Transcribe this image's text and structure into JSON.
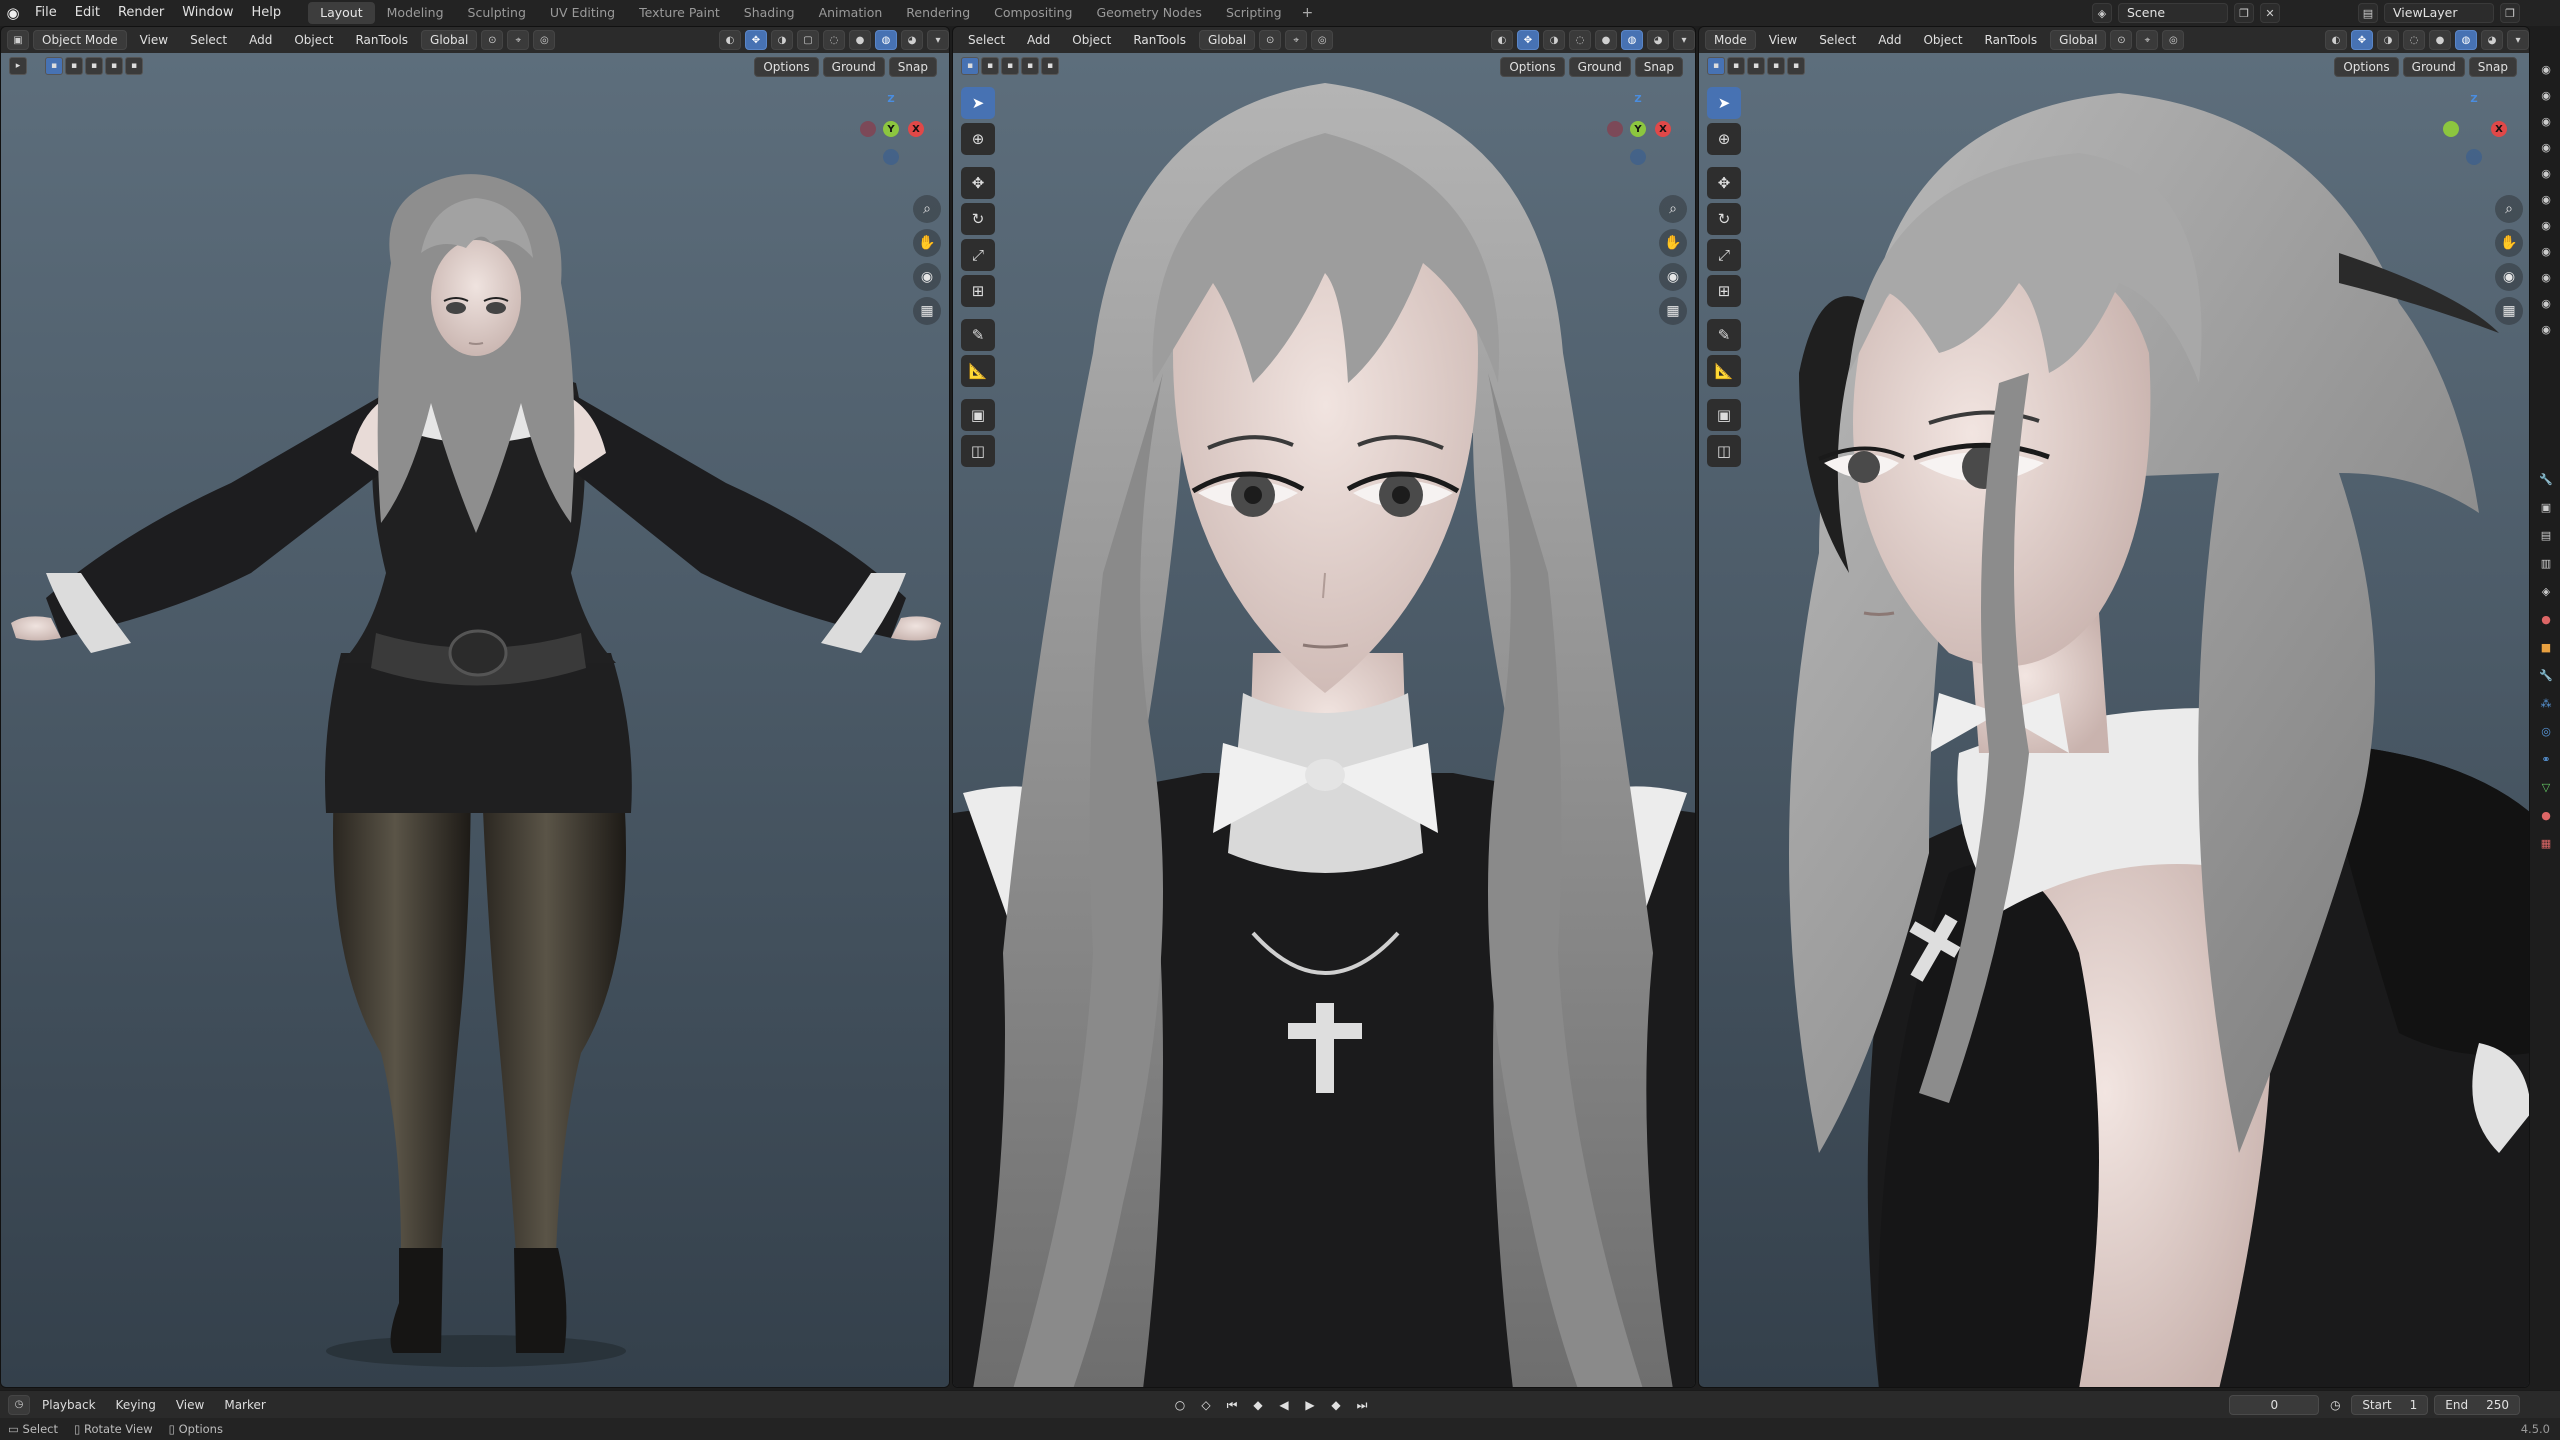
{
  "topbar": {
    "menu": [
      "File",
      "Edit",
      "Render",
      "Window",
      "Help"
    ],
    "workspaces": [
      "Layout",
      "Modeling",
      "Sculpting",
      "UV Editing",
      "Texture Paint",
      "Shading",
      "Animation",
      "Rendering",
      "Compositing",
      "Geometry Nodes",
      "Scripting"
    ],
    "active_workspace": "Layout",
    "add_tab": "+",
    "scene": "Scene",
    "view_layer": "ViewLayer"
  },
  "viewport1": {
    "mode": "Object Mode",
    "menus": [
      "View",
      "Select",
      "Add",
      "Object",
      "RanTools"
    ],
    "orientation": "Global",
    "options": "Options",
    "ground": "Ground",
    "snap": "Snap"
  },
  "viewport2": {
    "menus": [
      "Select",
      "Add",
      "Object",
      "RanTools"
    ],
    "orientation": "Global",
    "options": "Options",
    "ground": "Ground",
    "snap": "Snap"
  },
  "viewport3": {
    "mode": "Mode",
    "menus": [
      "View",
      "Select",
      "Add",
      "Object",
      "RanTools"
    ],
    "orientation": "Global",
    "options": "Options",
    "ground": "Ground",
    "snap": "Snap"
  },
  "gizmo": {
    "x": "X",
    "y": "Y",
    "z": "Z"
  },
  "timeline": {
    "menus": [
      "Playback",
      "Keying",
      "View",
      "Marker"
    ],
    "current_frame": "0",
    "start_label": "Start",
    "start": "1",
    "end_label": "End",
    "end": "250"
  },
  "statusbar": {
    "select": "Select",
    "rotate": "Rotate View",
    "options": "Options",
    "version": "4.5.0"
  },
  "colors": {
    "accent": "#4772b3",
    "bg_top": "#5d6e7c",
    "bg_bottom": "#34404b"
  }
}
